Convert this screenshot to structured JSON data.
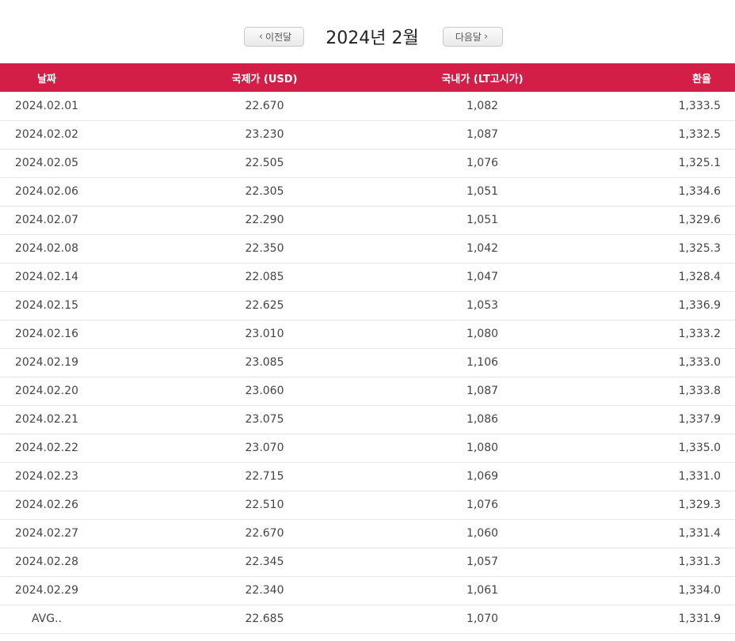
{
  "nav": {
    "prev_label": "이전달",
    "next_label": "다음달",
    "prev_icon": "chevron-left-icon",
    "next_icon": "chevron-right-icon",
    "month_title": "2024년 2월"
  },
  "colors": {
    "header_bg": "#d31f48",
    "header_text": "#ffffff"
  },
  "table": {
    "headers": [
      "날짜",
      "국제가 (USD)",
      "국내가 (LT고시가)",
      "환율"
    ],
    "rows": [
      [
        "2024.02.01",
        "22.670",
        "1,082",
        "1,333.5"
      ],
      [
        "2024.02.02",
        "23.230",
        "1,087",
        "1,332.5"
      ],
      [
        "2024.02.05",
        "22.505",
        "1,076",
        "1,325.1"
      ],
      [
        "2024.02.06",
        "22.305",
        "1,051",
        "1,334.6"
      ],
      [
        "2024.02.07",
        "22.290",
        "1,051",
        "1,329.6"
      ],
      [
        "2024.02.08",
        "22.350",
        "1,042",
        "1,325.3"
      ],
      [
        "2024.02.14",
        "22.085",
        "1,047",
        "1,328.4"
      ],
      [
        "2024.02.15",
        "22.625",
        "1,053",
        "1,336.9"
      ],
      [
        "2024.02.16",
        "23.010",
        "1,080",
        "1,333.2"
      ],
      [
        "2024.02.19",
        "23.085",
        "1,106",
        "1,333.0"
      ],
      [
        "2024.02.20",
        "23.060",
        "1,087",
        "1,333.8"
      ],
      [
        "2024.02.21",
        "23.075",
        "1,086",
        "1,337.9"
      ],
      [
        "2024.02.22",
        "23.070",
        "1,080",
        "1,335.0"
      ],
      [
        "2024.02.23",
        "22.715",
        "1,069",
        "1,331.0"
      ],
      [
        "2024.02.26",
        "22.510",
        "1,076",
        "1,329.3"
      ],
      [
        "2024.02.27",
        "22.670",
        "1,060",
        "1,331.4"
      ],
      [
        "2024.02.28",
        "22.345",
        "1,057",
        "1,331.3"
      ],
      [
        "2024.02.29",
        "22.340",
        "1,061",
        "1,334.0"
      ],
      [
        "AVG..",
        "22.685",
        "1,070",
        "1,331.9"
      ]
    ]
  }
}
